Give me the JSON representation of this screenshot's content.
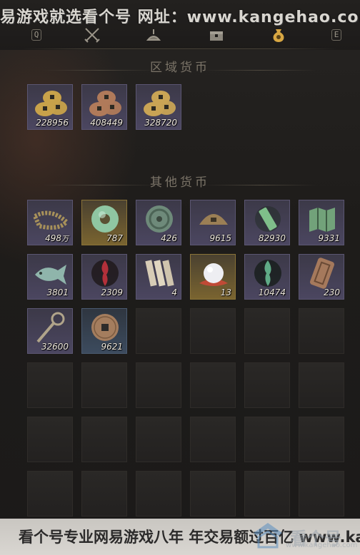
{
  "watermark_top": "易游戏就选看个号   网址：www.kangehao.com",
  "tabs": [
    {
      "name": "tab-quest",
      "key": "Q"
    },
    {
      "name": "tab-weapons"
    },
    {
      "name": "tab-scale"
    },
    {
      "name": "tab-chest"
    },
    {
      "name": "tab-currency",
      "active": true
    },
    {
      "name": "tab-next",
      "key": "E"
    }
  ],
  "sections": {
    "regional_currency": "区域货币",
    "other_currency": "其他货币"
  },
  "regional_items": [
    {
      "icon": "gold-coin-pile-icon",
      "count": "228956",
      "rarity": "purple",
      "color": "#c8a24a"
    },
    {
      "icon": "copper-coin-pile-icon",
      "count": "408449",
      "rarity": "purple",
      "color": "#b07a5a"
    },
    {
      "icon": "bronze-coin-pile-icon",
      "count": "328720",
      "rarity": "purple",
      "color": "#c9a455"
    }
  ],
  "other_items": [
    {
      "icon": "coin-string-icon",
      "count": "498",
      "unit": "万",
      "rarity": "purple"
    },
    {
      "icon": "jade-disc-icon",
      "count": "787",
      "rarity": "gold"
    },
    {
      "icon": "bronze-medallion-icon",
      "count": "426",
      "rarity": "purple"
    },
    {
      "icon": "bronze-crescent-coin-icon",
      "count": "9615",
      "rarity": "purple"
    },
    {
      "icon": "green-scroll-token-icon",
      "count": "82930",
      "rarity": "purple"
    },
    {
      "icon": "green-map-token-icon",
      "count": "9331",
      "rarity": "purple"
    },
    {
      "icon": "jade-fish-icon",
      "count": "3801",
      "rarity": "purple"
    },
    {
      "icon": "red-flame-token-icon",
      "count": "2309",
      "rarity": "purple"
    },
    {
      "icon": "bamboo-slips-icon",
      "count": "4",
      "rarity": "purple"
    },
    {
      "icon": "pearl-icon",
      "count": "13",
      "rarity": "gold"
    },
    {
      "icon": "green-flame-token-icon",
      "count": "10474",
      "rarity": "purple"
    },
    {
      "icon": "bronze-tablet-icon",
      "count": "230",
      "rarity": "purple"
    },
    {
      "icon": "coin-sword-icon",
      "count": "32600",
      "rarity": "purple"
    },
    {
      "icon": "bronze-coin-icon",
      "count": "9621",
      "rarity": "blue"
    }
  ],
  "bottom_banner": {
    "text": "看个号专业网易游戏八年  年交易额过百亿  www.kangehao.com",
    "logo_text": "看个号",
    "logo_url": "www.kangehao.com"
  }
}
